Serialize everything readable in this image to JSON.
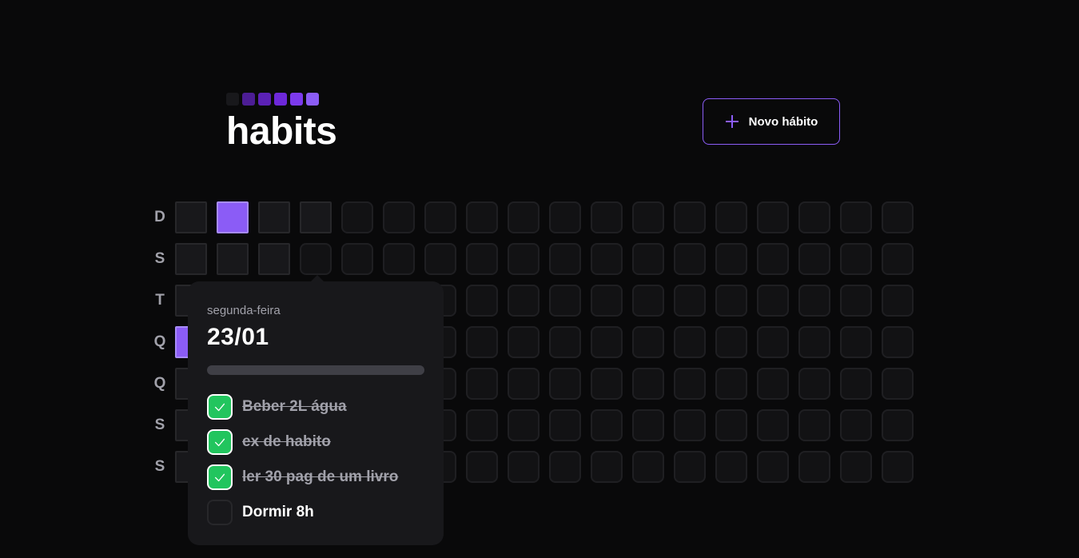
{
  "app": {
    "title": "habits"
  },
  "logo": {
    "square_colors": [
      "#18181b",
      "#4c1d95",
      "#5b21b6",
      "#6d28d9",
      "#7c3aed",
      "#8b5cf6"
    ]
  },
  "header": {
    "new_habit_label": "Novo hábito"
  },
  "colors": {
    "accent": "#8b5cf6",
    "success": "#22c55e",
    "background": "#09090a",
    "panel": "#18181b"
  },
  "weekdays": [
    "D",
    "S",
    "T",
    "Q",
    "Q",
    "S",
    "S"
  ],
  "summary": {
    "columns": 18,
    "rows": 7,
    "total_days": 22,
    "completed_days": [
      3,
      7
    ]
  },
  "popover": {
    "weekday": "segunda-feira",
    "date": "23/01",
    "progress": 0,
    "habits": [
      {
        "label": "Beber 2L água",
        "completed": true
      },
      {
        "label": "ex de habito",
        "completed": true
      },
      {
        "label": "ler 30 pag de um livro",
        "completed": true
      },
      {
        "label": "Dormir 8h",
        "completed": false
      }
    ]
  }
}
